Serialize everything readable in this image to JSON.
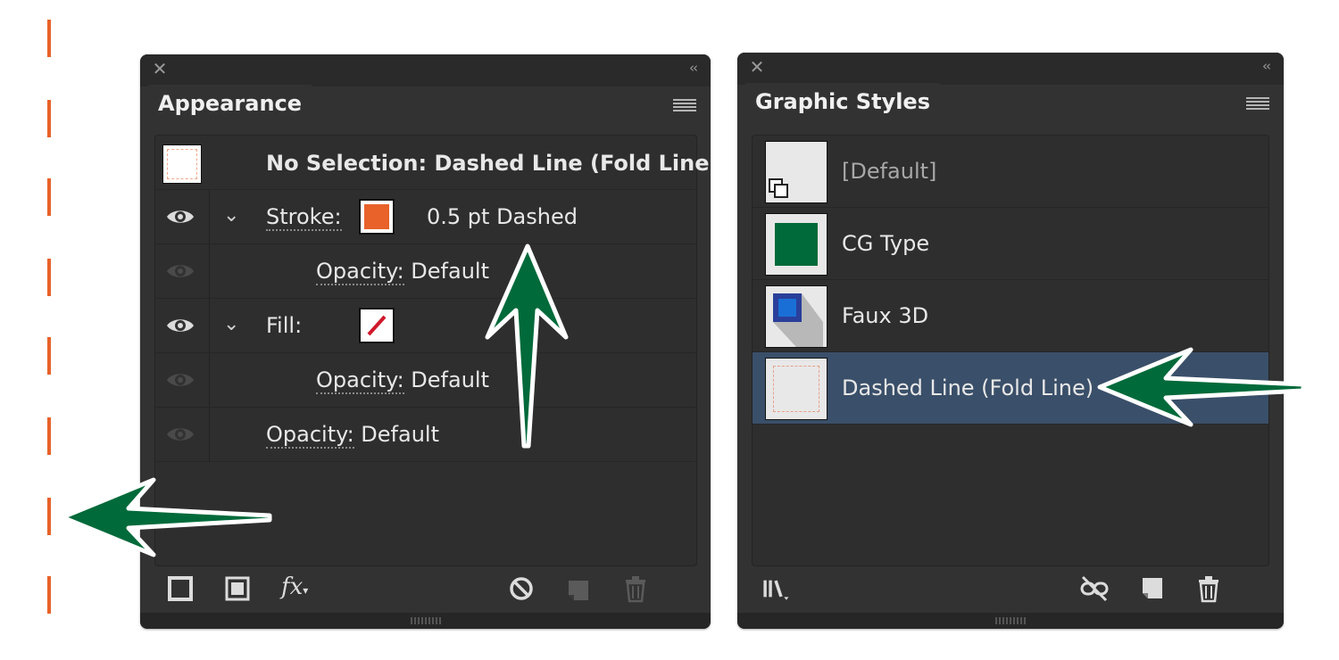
{
  "colors": {
    "fold_line": "#e8622a",
    "arrow_fill": "#006a3a",
    "stroke_swatch": "#e8622a",
    "highlight_row": "#3a4f69",
    "panel_bg": "#323232"
  },
  "appearance_panel": {
    "tab_label": "Appearance",
    "header": "No Selection: Dashed Line (Fold Line)",
    "rows": [
      {
        "label": "Stroke:",
        "value": "0.5 pt Dashed",
        "visible": true,
        "expanded": true
      },
      {
        "label": "Opacity:",
        "value": "Default",
        "visible": false
      },
      {
        "label": "Fill:",
        "value": "",
        "visible": true,
        "expanded": true,
        "swatch": "none"
      },
      {
        "label": "Opacity:",
        "value": "Default",
        "visible": false
      },
      {
        "label": "Opacity:",
        "value": "Default",
        "visible": false
      }
    ],
    "footer_icons": [
      "add-new-stroke-icon",
      "add-new-fill-icon",
      "add-new-effect-icon",
      "clear-appearance-icon",
      "duplicate-item-icon",
      "delete-item-icon"
    ]
  },
  "graphic_styles_panel": {
    "tab_label": "Graphic Styles",
    "styles": [
      {
        "name": "[Default]",
        "selected": false
      },
      {
        "name": "CG Type",
        "selected": false
      },
      {
        "name": "Faux 3D",
        "selected": false
      },
      {
        "name": "Dashed Line (Fold Line)",
        "selected": true
      }
    ],
    "footer_icons": [
      "style-libraries-icon",
      "break-link-icon",
      "new-style-icon",
      "delete-style-icon"
    ]
  }
}
